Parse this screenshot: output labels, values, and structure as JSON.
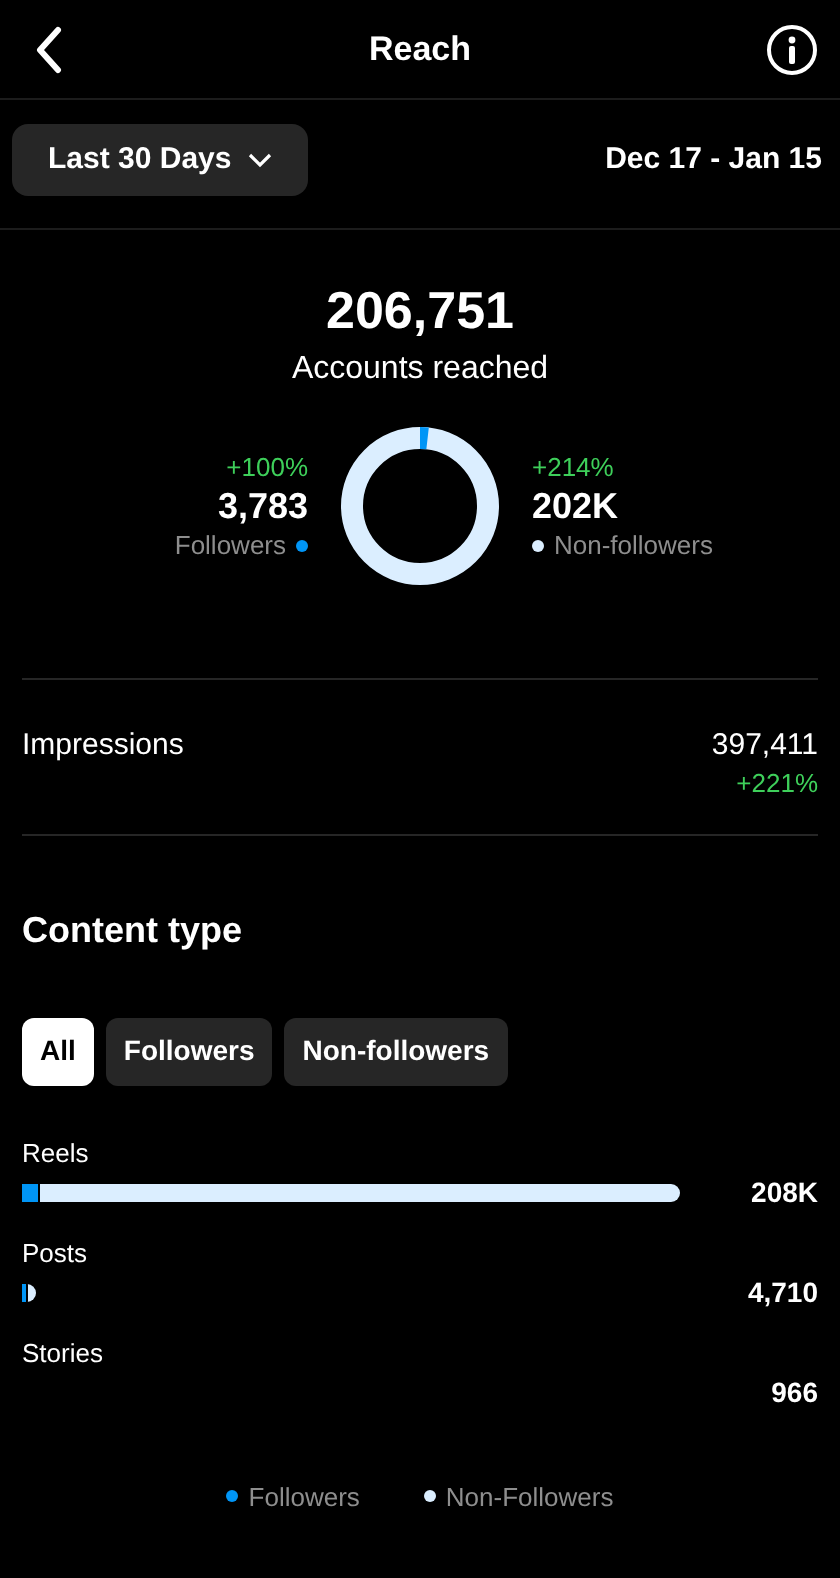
{
  "header": {
    "title": "Reach"
  },
  "range": {
    "dropdown": "Last 30 Days",
    "dates": "Dec 17 - Jan 15"
  },
  "reach": {
    "total": "206,751",
    "label": "Accounts reached",
    "followers": {
      "change": "+100%",
      "value": "3,783",
      "label": "Followers",
      "color": "#0095f6"
    },
    "non_followers": {
      "change": "+214%",
      "value": "202K",
      "label": "Non-followers",
      "color": "#dbeeff"
    }
  },
  "impressions": {
    "label": "Impressions",
    "value": "397,411",
    "change": "+221%"
  },
  "content_type": {
    "title": "Content type",
    "filters": [
      {
        "label": "All",
        "selected": true
      },
      {
        "label": "Followers",
        "selected": false
      },
      {
        "label": "Non-followers",
        "selected": false
      }
    ],
    "rows": [
      {
        "label": "Reels",
        "value": "208K",
        "kind": "long"
      },
      {
        "label": "Posts",
        "value": "4,710",
        "kind": "short"
      },
      {
        "label": "Stories",
        "value": "966",
        "kind": "empty"
      }
    ],
    "legend": [
      {
        "label": "Followers",
        "color": "#0095f6"
      },
      {
        "label": "Non-Followers",
        "color": "#dbeeff"
      }
    ]
  }
}
